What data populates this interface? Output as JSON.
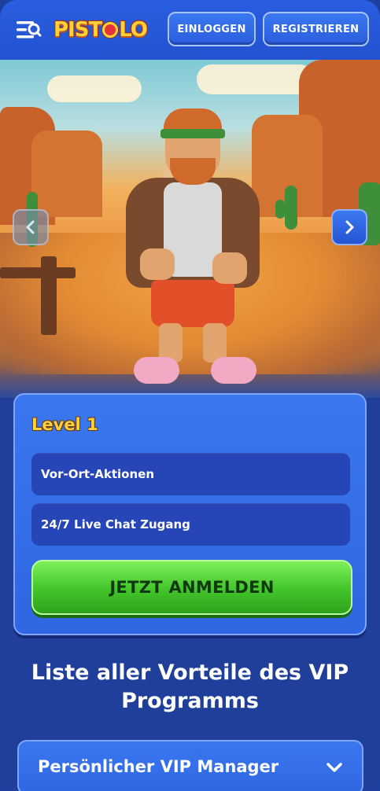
{
  "header": {
    "logo_text": "PISTOLO",
    "login_label": "EINLOGGEN",
    "register_label": "REGISTRIEREN"
  },
  "hero": {
    "prev_icon": "chevron-left-icon",
    "next_icon": "chevron-right-icon"
  },
  "level_card": {
    "title": "Level 1",
    "perks": [
      "Vor-Ort-Aktionen",
      "24/7 Live Chat Zugang"
    ],
    "cta_label": "JETZT ANMELDEN"
  },
  "vip_section": {
    "title": "Liste aller Vorteile des VIP Programms",
    "items": [
      {
        "label": "Persönlicher VIP Manager",
        "icon": "chevron-down-icon"
      }
    ]
  },
  "colors": {
    "header_bg": "#2252d0",
    "page_bg": "#1f3f9a",
    "card_bg": "#2f66e2",
    "perk_bg": "#2646b7",
    "cta_green": "#42c42a",
    "level_yellow": "#ffd23a"
  }
}
